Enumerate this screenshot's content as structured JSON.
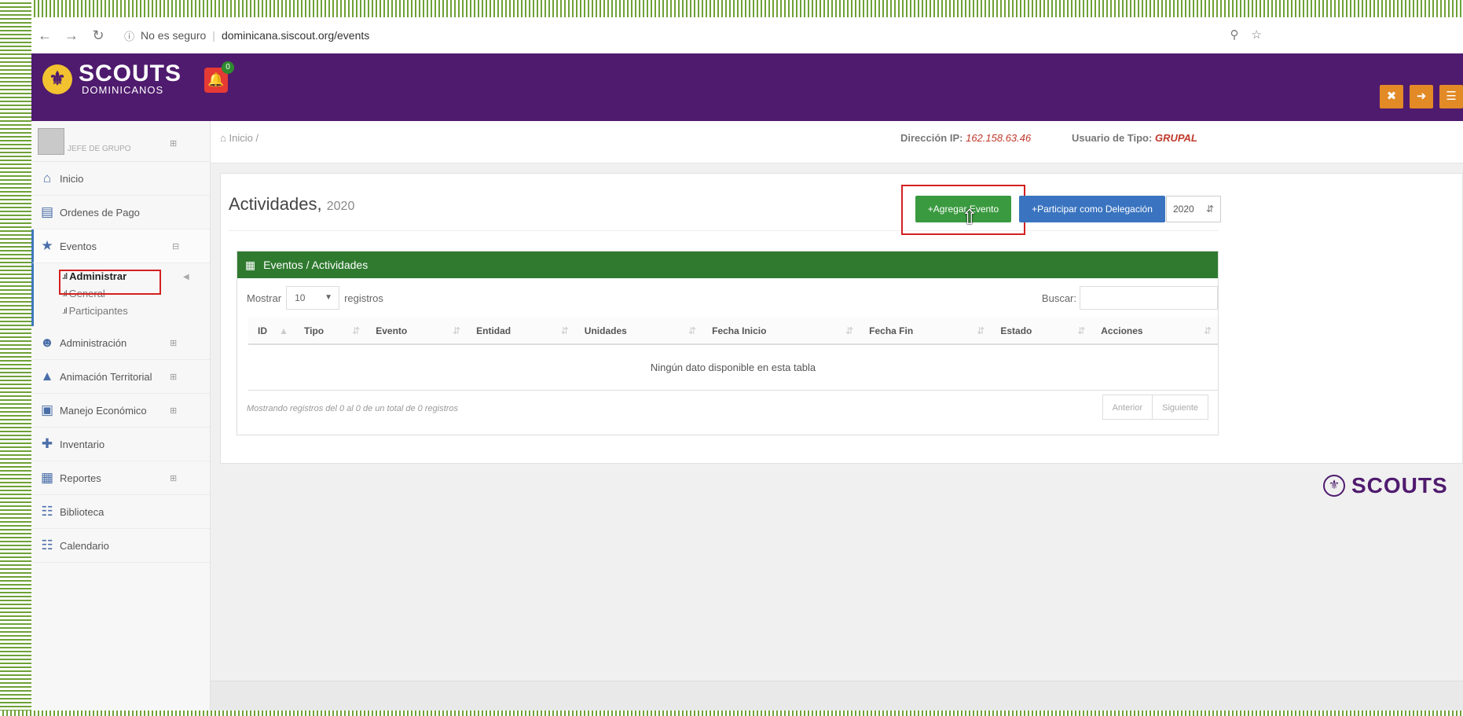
{
  "browser": {
    "security_label": "No es seguro",
    "separator": "|",
    "url": "dominicana.siscout.org/events",
    "icons": [
      "back-icon",
      "forward-icon",
      "reload-icon",
      "info-icon",
      "zoom-icon",
      "star-icon"
    ]
  },
  "header": {
    "logo_title": "SCOUTS",
    "logo_subtitle": "DOMINICANOS",
    "notification_count": "0",
    "colors": {
      "background": "#4f1b6e",
      "buttons": "#e28a26",
      "bell": "#e63a34"
    },
    "buttons": [
      "fullscreen-icon",
      "logout-icon",
      "menu-icon"
    ]
  },
  "sidebar": {
    "user_role": "JEFE DE GRUPO",
    "items": [
      {
        "label": "Inicio",
        "icon": "home-icon"
      },
      {
        "label": "Ordenes de Pago",
        "icon": "book-icon"
      },
      {
        "label": "Eventos",
        "icon": "trophy-icon"
      },
      {
        "label": "Administración",
        "icon": "users-icon"
      },
      {
        "label": "Animación Territorial",
        "icon": "graduation-cap-icon"
      },
      {
        "label": "Manejo Económico",
        "icon": "money-icon"
      },
      {
        "label": "Inventario",
        "icon": "plus-icon"
      },
      {
        "label": "Reportes",
        "icon": "bar-chart-icon"
      },
      {
        "label": "Biblioteca",
        "icon": "sitemap-icon"
      },
      {
        "label": "Calendario",
        "icon": "calendar-icon"
      }
    ],
    "eventos_sub": [
      {
        "label": "Administrar"
      },
      {
        "label": "General"
      },
      {
        "label": "Participantes"
      }
    ]
  },
  "breadcrumb": {
    "label": "Inicio /"
  },
  "ip": {
    "label": "Dirección IP:",
    "value": "162.158.63.46"
  },
  "user_type": {
    "label": "Usuario de Tipo:",
    "value": "GRUPAL"
  },
  "page": {
    "title": "Actividades,",
    "year": "2020",
    "add_button": "+Agregar Evento",
    "delegation_button": "+Participar como Delegación",
    "year_select": "2020"
  },
  "table_box": {
    "title": "Eventos / Actividades",
    "length_label_pre": "Mostrar",
    "length_value": "10",
    "length_label_post": "registros",
    "search_label": "Buscar:",
    "columns": [
      "ID",
      "Tipo",
      "Evento",
      "Entidad",
      "Unidades",
      "Fecha Inicio",
      "Fecha Fin",
      "Estado",
      "Acciones"
    ],
    "empty_message": "Ningún dato disponible en esta tabla",
    "info": "Mostrando registros del 0 al 0 de un total de 0 registros",
    "prev": "Anterior",
    "next": "Siguiente"
  },
  "footer_brand": {
    "name": "SCOUTS"
  }
}
